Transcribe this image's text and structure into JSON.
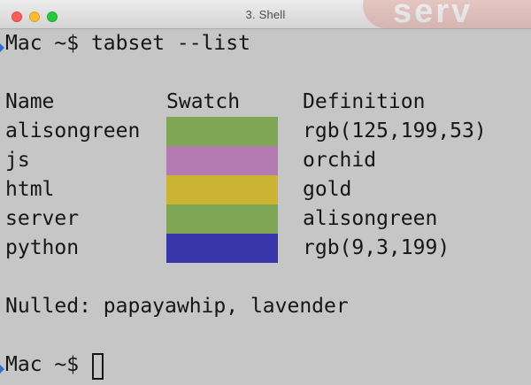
{
  "window": {
    "title": "3. Shell",
    "badge_text": "serv"
  },
  "terminal": {
    "prompt": "Mac ~$",
    "command": "tabset --list",
    "headers": {
      "name": "Name",
      "swatch": "Swatch",
      "definition": "Definition"
    },
    "rows": [
      {
        "name": "alisongreen",
        "definition": "rgb(125,199,53)",
        "color": "#7fa655"
      },
      {
        "name": "js",
        "definition": "orchid",
        "color": "#b47bb2"
      },
      {
        "name": "html",
        "definition": "gold",
        "color": "#cbb333"
      },
      {
        "name": "server",
        "definition": "alisongreen",
        "color": "#7fa655"
      },
      {
        "name": "python",
        "definition": "rgb(9,3,199)",
        "color": "#3836a8"
      }
    ],
    "nulled_line": "Nulled: papayawhip, lavender",
    "final_prompt": "Mac ~$"
  },
  "colors": {
    "terminal_bg": "#c6c6c6",
    "text": "#161616",
    "marker": "#2f6fc9"
  }
}
